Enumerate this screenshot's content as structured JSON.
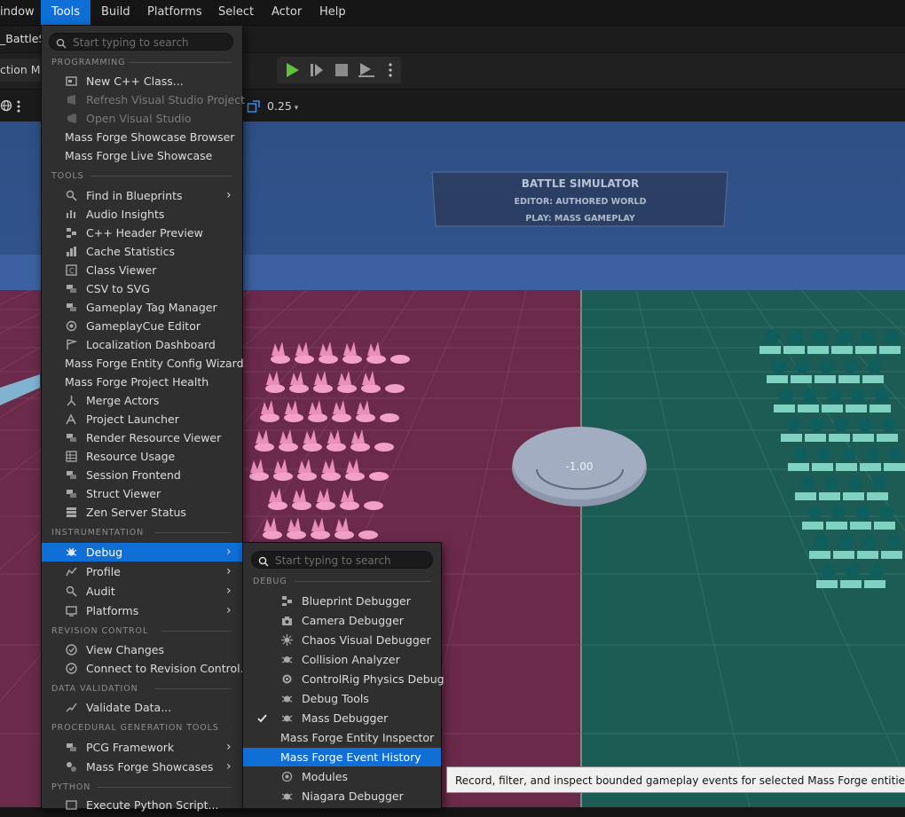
{
  "menubar": {
    "items": [
      {
        "label": "indow"
      },
      {
        "label": "Tools"
      },
      {
        "label": "Build"
      },
      {
        "label": "Platforms"
      },
      {
        "label": "Select"
      },
      {
        "label": "Actor"
      },
      {
        "label": "Help"
      }
    ]
  },
  "level_tab": {
    "label": "_BattleSi"
  },
  "toolbar": {
    "mode_label": "ction Mo"
  },
  "viewport_toolbar": {
    "snap_value": "0.25"
  },
  "viewport": {
    "sign": {
      "title": "BATTLE SIMULATOR",
      "line1": "EDITOR: AUTHORED WORLD",
      "line2": "PLAY: MASS GAMEPLAY"
    },
    "dial_value": "-1.00",
    "red_team_color": "#f2a0c8",
    "teal_team_color": "#0e5e5e"
  },
  "tools_menu": {
    "search_placeholder": "Start typing to search",
    "sections": {
      "programming": "PROGRAMMING",
      "tools": "TOOLS",
      "instrumentation": "INSTRUMENTATION",
      "revision": "REVISION CONTROL",
      "validation": "DATA VALIDATION",
      "pcg": "PROCEDURAL GENERATION TOOLS",
      "python": "PYTHON"
    },
    "programming_items": [
      {
        "label": "New C++ Class...",
        "icon": "cpp-class-icon"
      },
      {
        "label": "Refresh Visual Studio Project",
        "icon": "refresh-vs-icon",
        "disabled": true
      },
      {
        "label": "Open Visual Studio",
        "icon": "visual-studio-icon",
        "disabled": true
      },
      {
        "label": "Mass Forge Showcase Browser"
      },
      {
        "label": "Mass Forge Live Showcase"
      }
    ],
    "tools_items": [
      {
        "label": "Find in Blueprints",
        "icon": "find-blueprints-icon",
        "submenu": true
      },
      {
        "label": "Audio Insights",
        "icon": "audio-insights-icon"
      },
      {
        "label": "C++ Header Preview",
        "icon": "header-preview-icon"
      },
      {
        "label": "Cache Statistics",
        "icon": "cache-stats-icon"
      },
      {
        "label": "Class Viewer",
        "icon": "class-viewer-icon"
      },
      {
        "label": "CSV to SVG",
        "icon": "csv-svg-icon"
      },
      {
        "label": "Gameplay Tag Manager",
        "icon": "tag-manager-icon"
      },
      {
        "label": "GameplayCue Editor",
        "icon": "gameplaycue-icon"
      },
      {
        "label": "Localization Dashboard",
        "icon": "localization-icon"
      },
      {
        "label": "Mass Forge Entity Config Wizard"
      },
      {
        "label": "Mass Forge Project Health"
      },
      {
        "label": "Merge Actors",
        "icon": "merge-actors-icon"
      },
      {
        "label": "Project Launcher",
        "icon": "project-launcher-icon"
      },
      {
        "label": "Render Resource Viewer",
        "icon": "render-resource-icon"
      },
      {
        "label": "Resource Usage",
        "icon": "resource-usage-icon"
      },
      {
        "label": "Session Frontend",
        "icon": "session-frontend-icon"
      },
      {
        "label": "Struct Viewer",
        "icon": "struct-viewer-icon"
      },
      {
        "label": "Zen Server Status",
        "icon": "zen-server-icon"
      }
    ],
    "instrumentation_items": [
      {
        "label": "Debug",
        "icon": "debug-bug-icon",
        "submenu": true,
        "highlighted": true
      },
      {
        "label": "Profile",
        "icon": "profile-icon",
        "submenu": true
      },
      {
        "label": "Audit",
        "icon": "audit-icon",
        "submenu": true
      },
      {
        "label": "Platforms",
        "icon": "platforms-icon",
        "submenu": true
      }
    ],
    "revision_items": [
      {
        "label": "View Changes",
        "icon": "view-changes-icon"
      },
      {
        "label": "Connect to Revision Control...",
        "icon": "revision-connect-icon"
      }
    ],
    "validation_items": [
      {
        "label": "Validate Data...",
        "icon": "validate-data-icon"
      }
    ],
    "pcg_items": [
      {
        "label": "PCG Framework",
        "icon": "pcg-framework-icon",
        "submenu": true
      },
      {
        "label": "Mass Forge Showcases",
        "icon": "pcg-showcases-icon",
        "submenu": true
      }
    ],
    "python_items": [
      {
        "label": "Execute Python Script...",
        "icon": "python-script-icon"
      }
    ]
  },
  "debug_menu": {
    "search_placeholder": "Start typing to search",
    "section": "DEBUG",
    "items": [
      {
        "label": "Blueprint Debugger",
        "icon": "blueprint-debugger-icon"
      },
      {
        "label": "Camera Debugger",
        "icon": "camera-debugger-icon"
      },
      {
        "label": "Chaos Visual Debugger",
        "icon": "chaos-debugger-icon"
      },
      {
        "label": "Collision Analyzer",
        "icon": "collision-analyzer-icon"
      },
      {
        "label": "ControlRig Physics Debug",
        "icon": "controlrig-debug-icon"
      },
      {
        "label": "Debug Tools",
        "icon": "debug-tools-icon"
      },
      {
        "label": "Mass Debugger",
        "icon": "mass-debugger-icon",
        "checked": true
      },
      {
        "label": "Mass Forge Entity Inspector"
      },
      {
        "label": "Mass Forge Event History",
        "highlighted": true
      },
      {
        "label": "Modules",
        "icon": "modules-icon"
      },
      {
        "label": "Niagara Debugger",
        "icon": "niagara-debugger-icon"
      }
    ]
  },
  "tooltip": {
    "text": "Record, filter, and inspect bounded gameplay events for selected Mass Forge entities."
  }
}
